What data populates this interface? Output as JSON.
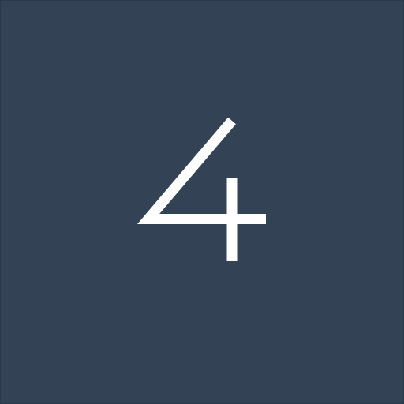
{
  "tile": {
    "label": "4",
    "background_color": "#334255",
    "glyph_color": "#ffffff"
  }
}
